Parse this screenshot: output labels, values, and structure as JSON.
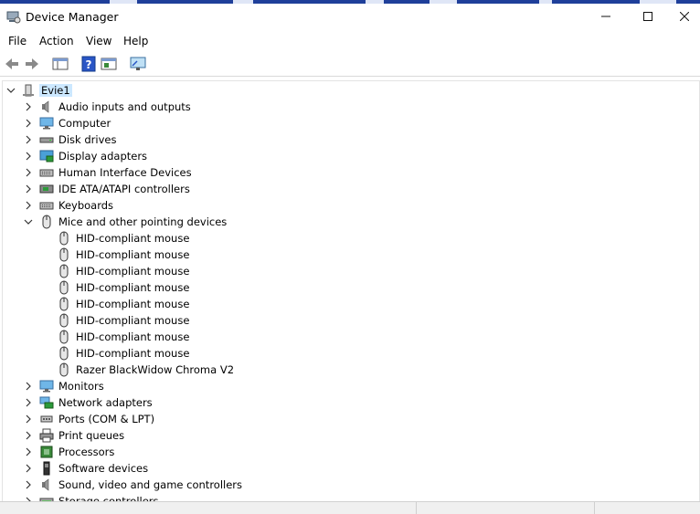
{
  "window": {
    "title": "Device Manager",
    "minimize": "—",
    "maximize": "☐",
    "close": "✕"
  },
  "menu": [
    {
      "key": "file",
      "label": "File"
    },
    {
      "key": "action",
      "label": "Action"
    },
    {
      "key": "view",
      "label": "View"
    },
    {
      "key": "help",
      "label": "Help"
    }
  ],
  "toolbar": [
    {
      "key": "back",
      "icon": "back-arrow-icon"
    },
    {
      "key": "forward",
      "icon": "forward-arrow-icon"
    },
    {
      "key": "show-hide-console",
      "icon": "console-tree-icon"
    },
    {
      "key": "help",
      "icon": "help-icon"
    },
    {
      "key": "properties",
      "icon": "properties-pane-icon"
    },
    {
      "key": "scan",
      "icon": "monitor-scan-icon"
    }
  ],
  "tree": {
    "root": {
      "label": "Evie1",
      "icon": "computer-tower-icon",
      "expanded": true
    },
    "items": [
      {
        "label": "Audio inputs and outputs",
        "icon": "speaker-icon",
        "expanded": false
      },
      {
        "label": "Computer",
        "icon": "monitor-icon",
        "expanded": false
      },
      {
        "label": "Disk drives",
        "icon": "disk-drive-icon",
        "expanded": false
      },
      {
        "label": "Display adapters",
        "icon": "display-adapter-icon",
        "expanded": false
      },
      {
        "label": "Human Interface Devices",
        "icon": "keyboard-icon",
        "expanded": false
      },
      {
        "label": "IDE ATA/ATAPI controllers",
        "icon": "controller-chip-icon",
        "expanded": false
      },
      {
        "label": "Keyboards",
        "icon": "keyboard-icon",
        "expanded": false
      },
      {
        "label": "Mice and other pointing devices",
        "icon": "mouse-icon",
        "expanded": true,
        "children": [
          "HID-compliant mouse",
          "HID-compliant mouse",
          "HID-compliant mouse",
          "HID-compliant mouse",
          "HID-compliant mouse",
          "HID-compliant mouse",
          "HID-compliant mouse",
          "HID-compliant mouse",
          "Razer BlackWidow Chroma V2"
        ]
      },
      {
        "label": "Monitors",
        "icon": "monitor-icon",
        "expanded": false
      },
      {
        "label": "Network adapters",
        "icon": "network-icon",
        "expanded": false
      },
      {
        "label": "Ports (COM & LPT)",
        "icon": "port-icon",
        "expanded": false
      },
      {
        "label": "Print queues",
        "icon": "printer-icon",
        "expanded": false
      },
      {
        "label": "Processors",
        "icon": "processor-icon",
        "expanded": false
      },
      {
        "label": "Software devices",
        "icon": "software-device-icon",
        "expanded": false
      },
      {
        "label": "Sound, video and game controllers",
        "icon": "speaker-icon",
        "expanded": false
      },
      {
        "label": "Storage controllers",
        "icon": "storage-controller-icon",
        "expanded": false
      }
    ]
  },
  "colors": {
    "selection": "#cce8ff",
    "title_strip": "#1f3f9a"
  }
}
